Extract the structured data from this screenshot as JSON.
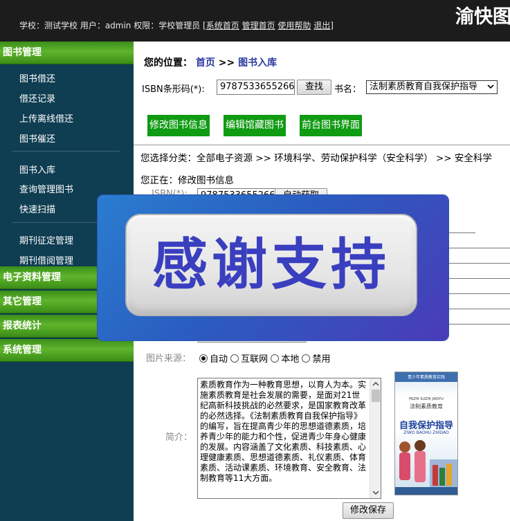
{
  "header": {
    "info_prefix": "学校：测试学校 用户：admin 权限：学校管理员 [",
    "links": [
      "系统首页",
      "管理首页",
      "使用帮助",
      "退出"
    ],
    "info_suffix": "]",
    "brand": "渝快图"
  },
  "sidebar": {
    "sections": [
      {
        "title": "图书管理",
        "items": [
          "图书借还",
          "借还记录",
          "上传离线借还",
          "图书催还",
          "图书入库",
          "查询管理图书",
          "快速扫描",
          "期刊征定管理",
          "期刊借阅管理"
        ]
      },
      {
        "title": "电子资料管理"
      },
      {
        "title": "其它管理"
      },
      {
        "title": "报表统计"
      },
      {
        "title": "系统管理"
      }
    ]
  },
  "breadcrumb": {
    "label": "您的位置：",
    "home": "首页",
    "sep": ">>",
    "current": "图书入库"
  },
  "search": {
    "isbn_label": "ISBN条形码(*):",
    "isbn_value": "9787533655266",
    "search_button": "查找",
    "title_label": "书名：",
    "title_selected": "法制素质教育自我保护指导"
  },
  "actions": [
    "修改图书信息",
    "编辑馆藏图书",
    "前台图书界面"
  ],
  "category_path": "您选择分类：全部电子资源 >> 环境科学、劳动保护科学（安全科学） >> 安全科学",
  "editing_label": "您正在：修改图书信息",
  "form": {
    "isbn_label": "ISBN(*):",
    "isbn_value": "9787533655266",
    "auto_fetch_button": "自动获取",
    "image_source_label": "图片来源：",
    "image_source_options": [
      "自动",
      "互联网",
      "本地",
      "禁用"
    ],
    "image_source_selected": "自动",
    "summary_label": "简介：",
    "summary_text": "素质教育作为一种教育思想，以育人为本。实施素质教育是社会发展的需要，是面对21世纪高新科技挑战的必然要求，是国家教育改革的必然选择。《法制素质教育自我保护指导》的编写，旨在提高青少年的思想道德素质，培养青少年的能力和个性，促进青少年身心健康的发展。内容涵盖了文化素质、科技素质、心理健康素质、思想道德素质、礼仪素质、体育素质、活动课素质、环境教育、安全教育、法制教育等11大方面。",
    "save_button": "修改保存"
  },
  "book_cover": {
    "top_line": "青少年素质教育实践",
    "pinyin": "FAZHI SUZHI JIAOYU",
    "series": "法制素质教育",
    "title": "自我保护指导",
    "title_pinyin": "ZIWO BAOHU ZHIDAO"
  },
  "overlay": {
    "text": "感谢支持"
  },
  "colors": {
    "green": "#0f9b12",
    "sidebar": "#0f3d52",
    "header": "#1c1c1c",
    "overlay_text": "#3a3fbf"
  }
}
